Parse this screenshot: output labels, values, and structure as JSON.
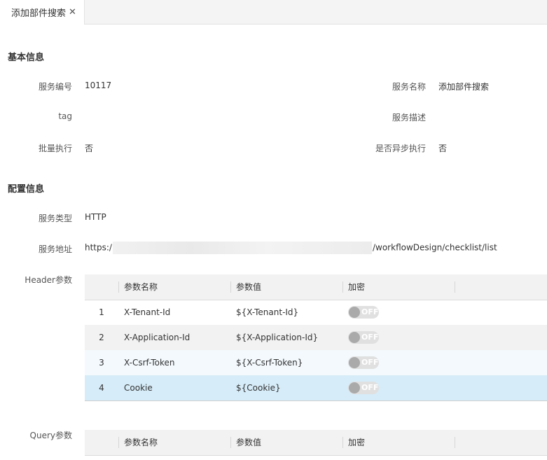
{
  "tab": {
    "title": "添加部件搜索",
    "close": "✕"
  },
  "basic": {
    "title": "基本信息",
    "service_no_label": "服务编号",
    "service_no": "10117",
    "service_name_label": "服务名称",
    "service_name": "添加部件搜索",
    "tag_label": "tag",
    "tag_value": "",
    "desc_label": "服务描述",
    "desc_value": "",
    "batch_label": "批量执行",
    "batch_value": "否",
    "async_label": "是否异步执行",
    "async_value": "否"
  },
  "config": {
    "title": "配置信息",
    "type_label": "服务类型",
    "type_value": "HTTP",
    "addr_label": "服务地址",
    "addr_prefix": "https:/",
    "addr_suffix": "/workflowDesign/checklist/list"
  },
  "header_params": {
    "label": "Header参数",
    "columns": [
      "参数名称",
      "参数值",
      "加密"
    ],
    "rows": [
      {
        "index": "1",
        "name": "X-Tenant-Id",
        "value": "${X-Tenant-Id}",
        "encrypt": "OFF"
      },
      {
        "index": "2",
        "name": "X-Application-Id",
        "value": "${X-Application-Id}",
        "encrypt": "OFF"
      },
      {
        "index": "3",
        "name": "X-Csrf-Token",
        "value": "${X-Csrf-Token}",
        "encrypt": "OFF"
      },
      {
        "index": "4",
        "name": "Cookie",
        "value": "${Cookie}",
        "encrypt": "OFF"
      }
    ]
  },
  "query_params": {
    "label": "Query参数",
    "columns": [
      "参数名称",
      "参数值",
      "加密"
    ]
  }
}
